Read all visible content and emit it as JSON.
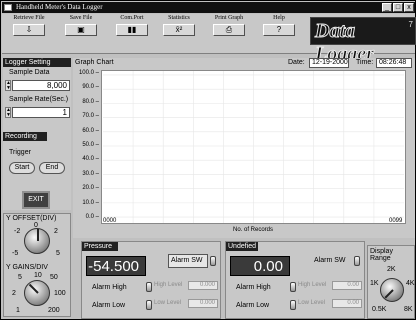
{
  "window": {
    "title": "Handheld Meter's Data Logger",
    "min_label": "_",
    "max_label": "□",
    "close_label": "x"
  },
  "toolbar": {
    "buttons": [
      {
        "label": "Retrieve File",
        "icon": "folder-open-icon",
        "glyph": "⇩"
      },
      {
        "label": "Save File",
        "icon": "floppy-disk-icon",
        "glyph": "▣"
      },
      {
        "label": "Com.Port",
        "icon": "plug-icon",
        "glyph": "▮▮"
      },
      {
        "label": "Statistics",
        "icon": "statistics-icon",
        "glyph": "x̄²"
      },
      {
        "label": "Print Graph",
        "icon": "printer-icon",
        "glyph": "⎙"
      },
      {
        "label": "Help",
        "icon": "help-icon",
        "glyph": "?"
      }
    ],
    "logo_text": "Data Logger",
    "logo_sup": "7"
  },
  "logger": {
    "heading": "Logger Setting",
    "sample_data_label": "Sample Data",
    "sample_data_value": "8,000",
    "sample_rate_label": "Sample Rate(Sec.)",
    "sample_rate_value": "1"
  },
  "recording": {
    "heading": "Recording",
    "trigger_label": "Trigger",
    "start_label": "Start",
    "end_label": "End",
    "exit_label": "EXIT"
  },
  "chart": {
    "tab_label": "Graph Chart",
    "date_label": "Date:",
    "date_value": "12-19-2000",
    "time_label": "Time:",
    "time_value": "08:26:48",
    "xlabel": "No. of Records",
    "x_start": "0000",
    "x_end": "0099",
    "yticks": [
      "100.0",
      "90.0",
      "80.0",
      "70.0",
      "60.0",
      "50.0",
      "40.0",
      "30.0",
      "20.0",
      "10.0",
      "0.0"
    ]
  },
  "chart_data": {
    "type": "line",
    "title": "",
    "xlabel": "No. of Records",
    "ylabel": "",
    "xlim": [
      0,
      99
    ],
    "ylim": [
      0,
      100
    ],
    "series": [],
    "grid": true
  },
  "knobs": {
    "yoffset_label": "Y OFFSET(DIV)",
    "yoffset_ticks": [
      "0",
      "-2",
      "2",
      "-5",
      "5"
    ],
    "ygains_label": "Y GAINS/DIV",
    "ygains_ticks": [
      "10",
      "5",
      "50",
      "2",
      "100",
      "1",
      "200"
    ]
  },
  "pressure": {
    "heading": "Pressure",
    "value": "-54.500",
    "alarm_sw": "Alarm SW",
    "alarm_high": "Alarm High",
    "alarm_low": "Alarm Low",
    "high_level": "High Level",
    "low_level": "Low Level",
    "high_value": "0.000",
    "low_value": "0.000"
  },
  "undefined_panel": {
    "heading": "Undefied",
    "value": "0.00",
    "alarm_sw": "Alarm SW",
    "alarm_high": "Alarm High",
    "alarm_low": "Alarm Low",
    "high_level": "High Level",
    "low_level": "Low Level",
    "high_value": "0.00",
    "low_value": "0.00"
  },
  "display_range": {
    "label": "Display Range",
    "ticks": [
      "2K",
      "1K",
      "4K",
      "0.5K",
      "8K"
    ]
  }
}
